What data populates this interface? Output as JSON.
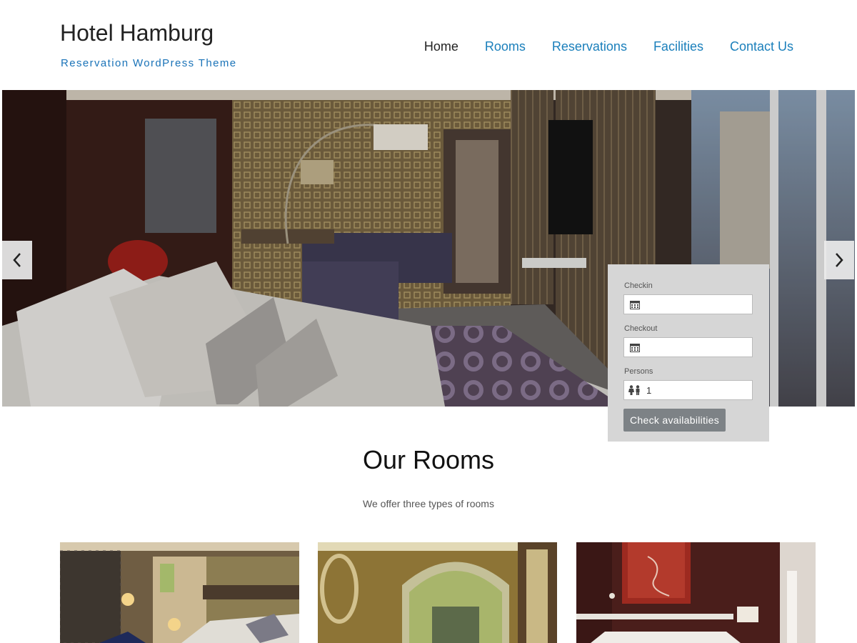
{
  "header": {
    "title": "Hotel Hamburg",
    "tagline": "Reservation WordPress Theme"
  },
  "nav": {
    "items": [
      {
        "label": "Home",
        "active": true
      },
      {
        "label": "Rooms"
      },
      {
        "label": "Reservations"
      },
      {
        "label": "Facilities"
      },
      {
        "label": "Contact Us"
      }
    ]
  },
  "slider": {
    "prev_icon": "chevron-left-icon",
    "next_icon": "chevron-right-icon"
  },
  "booking": {
    "checkin_label": "Checkin",
    "checkin_value": "",
    "checkout_label": "Checkout",
    "checkout_value": "",
    "persons_label": "Persons",
    "persons_value": "1",
    "button_label": "Check availabilities",
    "calendar_icon": "calendar-icon",
    "persons_icon": "people-icon"
  },
  "rooms": {
    "title": "Our Rooms",
    "subtitle": "We offer three types of rooms"
  },
  "colors": {
    "link": "#1a7fbb",
    "tagline": "#1a73b8",
    "button": "#7d8286",
    "form_bg": "#d6d6d6"
  }
}
